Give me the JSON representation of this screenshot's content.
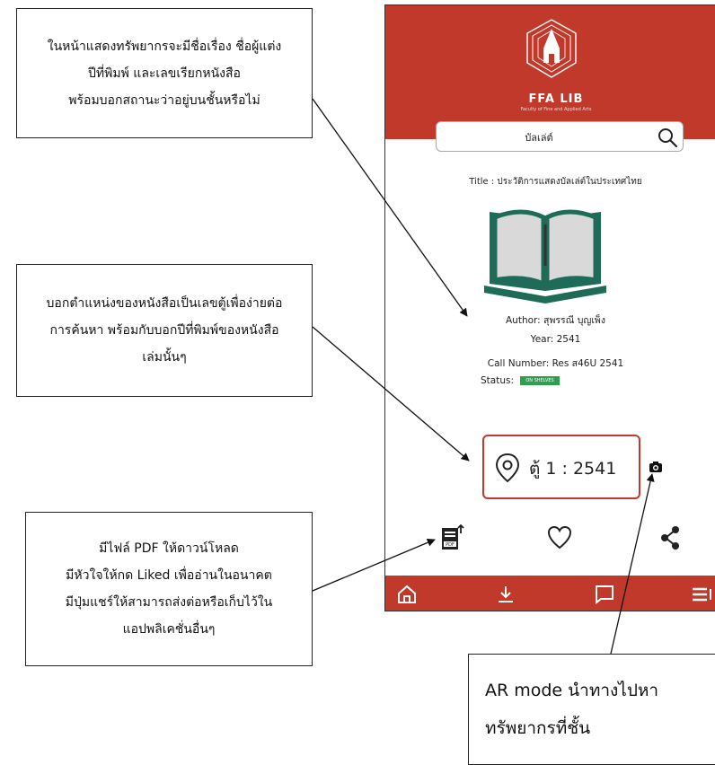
{
  "annotations": {
    "info_note": [
      "ในหน้าแสดงทรัพยากรจะมีชื่อเรื่อง ชื่อผู้แต่ง",
      "ปีที่พิมพ์ และเลขเรียกหนังสือ",
      "พร้อมบอกสถานะว่าอยู่บนชั้นหรือไม่"
    ],
    "location_note": [
      "บอกตำแหน่งของหนังสือเป็นเลขตู้เพื่อง่ายต่อ",
      "การค้นหา พร้อมกับบอกปีที่พิมพ์ของหนังสือ",
      "เล่มนั้นๆ"
    ],
    "actions_note": [
      "มีไฟล์ PDF ให้ดาวน์โหลด",
      "มีหัวใจให้กด Liked เพื่ออ่านในอนาคต",
      "มีปุ่มแชร์ให้สามารถส่งต่อหรือเก็บไว้ใน",
      "แอปพลิเคชั่นอื่นๆ"
    ],
    "ar_note": [
      "AR mode นำทางไปหา",
      "ทรัพยากรที่ชั้น"
    ]
  },
  "app": {
    "brand": "FFA LIB",
    "brand_sub": "Faculty of Fine and Applied Arts",
    "accent_color": "#c0392b",
    "search": {
      "value": "บัลเล่ต์",
      "icon": "search-icon"
    },
    "book": {
      "title": "Title : ประวัติการแสดงบัลเล่ต์ในประเทศไทย",
      "author": "Author: สุพรรณี บุญเพ็ง",
      "year": "Year: 2541",
      "call_number": "Call Number: Res ส46U 2541",
      "status_label": "Status:",
      "status_badge": "ON SHELVES",
      "status_color": "#2e9e4f"
    },
    "location": {
      "text": "ตู้ 1 : 2541",
      "icon": "location-pin-icon"
    },
    "ar_button_icon": "camera-icon",
    "actions": [
      "pdf-download-icon",
      "heart-icon",
      "share-icon"
    ],
    "bottom_nav": [
      "home-icon",
      "download-icon",
      "chat-icon",
      "menu-icon"
    ]
  }
}
